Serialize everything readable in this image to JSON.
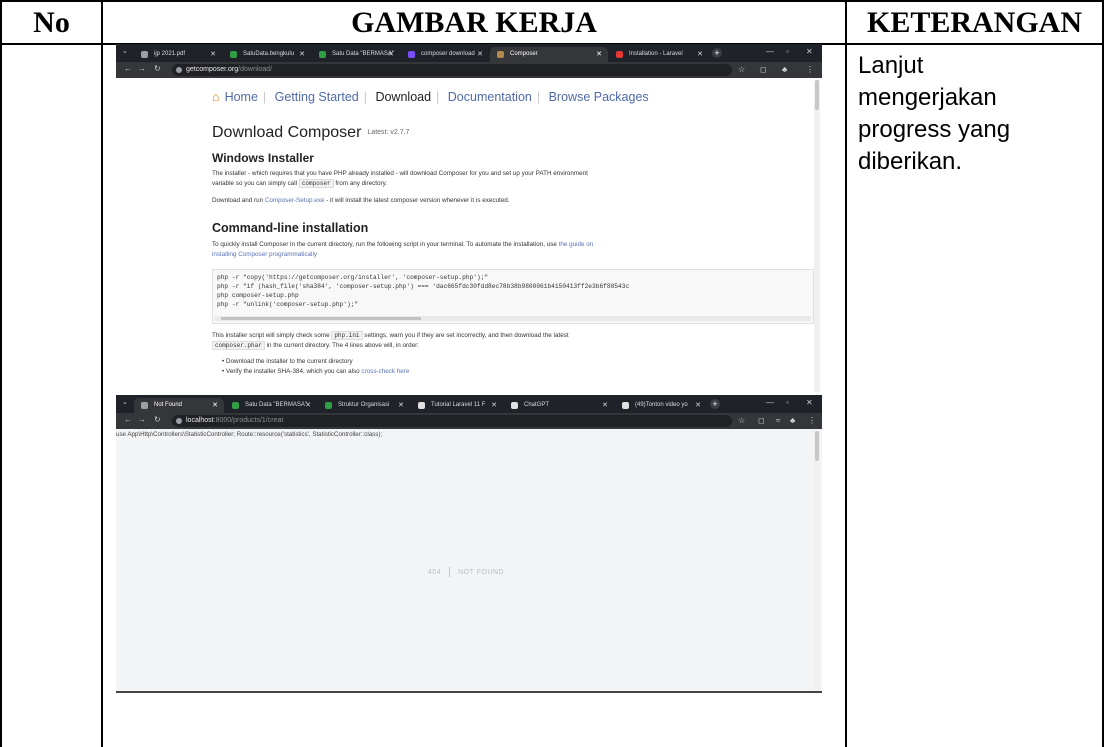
{
  "table": {
    "headers": {
      "no": "No",
      "gambar": "GAMBAR KERJA",
      "keterangan": "KETERANGAN"
    },
    "row": {
      "keterangan_lines": [
        "Lanjut",
        "mengerjakan",
        "progress yang",
        "diberikan."
      ]
    }
  },
  "screenshot1": {
    "tabs": [
      {
        "label": "ijp 2021.pdf",
        "color": "#9aa0a6"
      },
      {
        "label": "SatuData.bengkulu",
        "color": "#2f9e44"
      },
      {
        "label": "Satu Data \"BERMASA\"",
        "color": "#2f9e44"
      },
      {
        "label": "composer download",
        "color": "#7c4dff"
      },
      {
        "label": "Composer",
        "color": "#b08a4a",
        "active": true
      },
      {
        "label": "Installation - Laravel",
        "color": "#e53935"
      }
    ],
    "url_host": "getcomposer.org",
    "url_path": "/download/",
    "nav": {
      "home": "Home",
      "getting_started": "Getting Started",
      "download": "Download",
      "documentation": "Documentation",
      "browse_packages": "Browse Packages"
    },
    "title": "Download Composer",
    "version": "Latest: v2.7.7",
    "windows_heading": "Windows Installer",
    "windows_p1a": "The installer - which requires that you have PHP already installed - will download Composer for you and set up your PATH environment",
    "windows_p1b": "variable so you can simply call",
    "windows_p1_code": "composer",
    "windows_p1c": "from any directory.",
    "windows_p2a": "Download and run",
    "windows_p2_link": "Composer-Setup.exe",
    "windows_p2b": "- it will install the latest composer version whenever it is executed.",
    "cli_heading": "Command-line installation",
    "cli_p1a": "To quickly install Composer in the current directory, run the following script in your terminal. To automate the installation, use",
    "cli_p1_link1": "the guide on",
    "cli_p1_link2": "installing Composer programmatically",
    "code_lines": [
      "php -r \"copy('https://getcomposer.org/installer', 'composer-setup.php');\"",
      "php -r \"if (hash_file('sha384', 'composer-setup.php') === 'dac665fdc30fdd8ec78b38b9800061b4150413ff2e3b6f88543c",
      "php composer-setup.php",
      "php -r \"unlink('composer-setup.php');\""
    ],
    "after_a": "This installer script will simply check some",
    "after_code1": "php.ini",
    "after_b": "settings, warn you if they are set incorrectly, and then download the latest",
    "after_code2": "composer.phar",
    "after_c": "in the current directory. The 4 lines above will, in order:",
    "bullets": [
      "Download the installer to the current directory",
      "Verify the installer SHA-384, which you can also"
    ],
    "bullet2_link": "cross-check here"
  },
  "screenshot2": {
    "tabs": [
      {
        "label": "Not Found",
        "color": "#9aa0a6",
        "active": true
      },
      {
        "label": "Satu Data \"BERMASA\"",
        "color": "#2f9e44"
      },
      {
        "label": "Struktur Organisasi",
        "color": "#2f9e44"
      },
      {
        "label": "Tutorial Laravel 11 F",
        "color": "#e0e0e0"
      },
      {
        "label": "ChatGPT",
        "color": "#e0e0e0"
      },
      {
        "label": "(49)Tonton video yo",
        "color": "#e0e0e0"
      }
    ],
    "url_host": "localhost",
    "url_path": ":8000/products/1/creat",
    "error_line": "use App\\Http\\Controllers\\StatisticController; Route::resource('statistics', StatisticController::class);",
    "code": "404",
    "message": "NOT FOUND"
  }
}
